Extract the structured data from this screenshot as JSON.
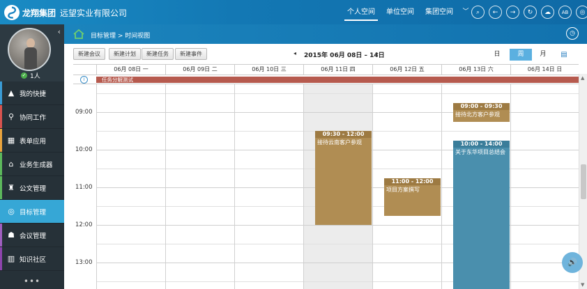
{
  "header": {
    "brand": "龙翔集团",
    "company": "远望实业有限公司",
    "tabs": [
      {
        "label": "个人空间",
        "active": true
      },
      {
        "label": "单位空间",
        "active": false
      },
      {
        "label": "集团空间",
        "active": false
      }
    ],
    "more_icon": "chevron-down-icon",
    "icons": [
      "search-icon",
      "back-icon",
      "forward-icon",
      "refresh-icon",
      "cloud-icon",
      "ab-icon",
      "settings-icon"
    ],
    "ab_text": "AB"
  },
  "user": {
    "online_count": "1人"
  },
  "sidebar": {
    "items": [
      {
        "label": "我的快捷",
        "icon": "triangle-icon",
        "color": "#3a9bd5"
      },
      {
        "label": "协同工作",
        "icon": "flow-icon",
        "color": "#d9534f"
      },
      {
        "label": "表单应用",
        "icon": "form-icon",
        "color": "#e8a33d"
      },
      {
        "label": "业务生成器",
        "icon": "home-icon",
        "color": "#5cb85c"
      },
      {
        "label": "公文管理",
        "icon": "stamp-icon",
        "color": "#5cb85c"
      },
      {
        "label": "目标管理",
        "icon": "target-icon",
        "color": "#36a7d6",
        "active": true
      },
      {
        "label": "会议管理",
        "icon": "meeting-icon",
        "color": "#a05fc0"
      },
      {
        "label": "知识社区",
        "icon": "book-icon",
        "color": "#8e44ad"
      }
    ],
    "more": "•••"
  },
  "breadcrumb": "目标管理 > 时间视图",
  "toolbar": {
    "buttons": [
      "新建会议",
      "新建计划",
      "新建任务",
      "新建事件"
    ],
    "range": "2015年 06月 08日 – 14日",
    "prev": "◂",
    "next": "▸",
    "views": [
      {
        "label": "日",
        "active": false
      },
      {
        "label": "周",
        "active": true
      },
      {
        "label": "月",
        "active": false
      }
    ]
  },
  "calendar": {
    "days": [
      "06月 08日 一",
      "06月 09日 二",
      "06月 10日 三",
      "06月 11日 四",
      "06月 12日 五",
      "06月 13日 六",
      "06月 14日 日"
    ],
    "today_index": 3,
    "allday_event": "任务分解测试",
    "allday_color": "#b65a4e",
    "hours": [
      "09:00",
      "10:00",
      "11:00",
      "12:00",
      "13:00"
    ],
    "events": [
      {
        "day": 3,
        "time": "09:30 - 12:00",
        "title": "接待云南客户参观",
        "start": 9.5,
        "end": 12.0,
        "color": "#b08d53",
        "header_color": "#9d7a42"
      },
      {
        "day": 4,
        "time": "11:00 - 12:00",
        "title": "项目方案撰写",
        "start": 10.75,
        "end": 11.75,
        "color": "#b08d53",
        "header_color": "#9d7a42"
      },
      {
        "day": 5,
        "time": "09:00 - 09:30",
        "title": "接待北方客户参观",
        "start": 8.75,
        "end": 9.25,
        "color": "#b08d53",
        "header_color": "#9d7a42"
      },
      {
        "day": 5,
        "time": "10:00 - 14:00",
        "title": "关于东华项目总结会",
        "start": 9.75,
        "end": 14.0,
        "color": "#4a8fad",
        "header_color": "#3a7d9a"
      }
    ]
  }
}
